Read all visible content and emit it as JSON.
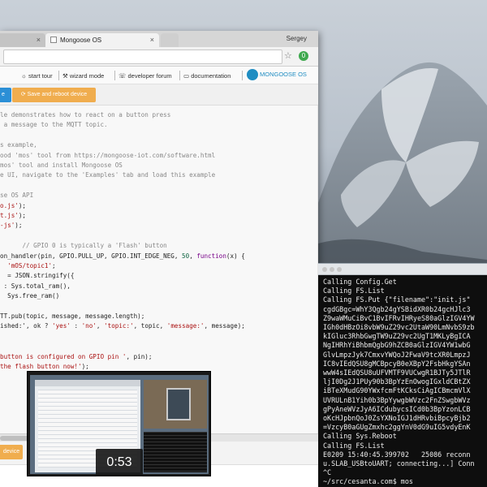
{
  "browser": {
    "tabs": [
      {
        "label": "",
        "active": false
      },
      {
        "label": "Mongoose OS",
        "active": true
      }
    ],
    "profile_name": "Sergey"
  },
  "nav": {
    "items": [
      {
        "icon": "lightbulb-icon",
        "glyph": "☼",
        "label": "start tour"
      },
      {
        "icon": "wand-icon",
        "glyph": "⚒",
        "label": "wizard mode"
      },
      {
        "icon": "chat-icon",
        "glyph": "☏",
        "label": "developer forum"
      },
      {
        "icon": "book-icon",
        "glyph": "▭",
        "label": "documentation"
      }
    ],
    "brand": "MONGOOSE OS"
  },
  "toolbar": {
    "left_button": "e",
    "save_button": "⟳ Save and reboot device"
  },
  "editor": {
    "lines": [
      [
        {
          "t": "le demonstrates how to react on a button press",
          "c": "c-com"
        }
      ],
      [
        {
          "t": " a message to the MQTT topic.",
          "c": "c-com"
        }
      ],
      [
        {
          "t": "",
          "c": ""
        }
      ],
      [
        {
          "t": "s example,",
          "c": "c-com"
        }
      ],
      [
        {
          "t": "ood 'mos' tool from https://mongoose-iot.com/software.html",
          "c": "c-com"
        }
      ],
      [
        {
          "t": "mos' tool and install Mongoose OS",
          "c": "c-com"
        }
      ],
      [
        {
          "t": "e UI, navigate to the 'Examples' tab and load this example",
          "c": "c-com"
        }
      ],
      [
        {
          "t": "",
          "c": ""
        }
      ],
      [
        {
          "t": "se OS API",
          "c": "c-com"
        }
      ],
      [
        {
          "t": "o.js'",
          "c": "c-str"
        },
        {
          "t": ");",
          "c": ""
        }
      ],
      [
        {
          "t": "t.js'",
          "c": "c-str"
        },
        {
          "t": ");",
          "c": ""
        }
      ],
      [
        {
          "t": "-js'",
          "c": "c-str"
        },
        {
          "t": ");",
          "c": ""
        }
      ],
      [
        {
          "t": "",
          "c": ""
        }
      ],
      [
        {
          "t": "      ",
          "c": ""
        },
        {
          "t": "// GPIO 0 is typically a 'Flash' button",
          "c": "c-com"
        }
      ],
      [
        {
          "t": "on_handler(pin, GPIO.PULL_UP, GPIO.INT_EDGE_NEG, ",
          "c": ""
        },
        {
          "t": "50",
          "c": "c-num"
        },
        {
          "t": ", ",
          "c": ""
        },
        {
          "t": "function",
          "c": "c-kw"
        },
        {
          "t": "(x) {",
          "c": ""
        }
      ],
      [
        {
          "t": "  ",
          "c": ""
        },
        {
          "t": "'mOS/topic1'",
          "c": "c-str"
        },
        {
          "t": ";",
          "c": ""
        }
      ],
      [
        {
          "t": "  = JSON.stringify({",
          "c": ""
        }
      ],
      [
        {
          "t": " : Sys.total_ram(),",
          "c": ""
        }
      ],
      [
        {
          "t": "  Sys.free_ram()",
          "c": ""
        }
      ],
      [
        {
          "t": "",
          "c": ""
        }
      ],
      [
        {
          "t": "TT.pub(topic, message, message.length);",
          "c": ""
        }
      ],
      [
        {
          "t": "ished:', ok ? ",
          "c": ""
        },
        {
          "t": "'yes'",
          "c": "c-str"
        },
        {
          "t": " : ",
          "c": ""
        },
        {
          "t": "'no'",
          "c": "c-str"
        },
        {
          "t": ", ",
          "c": ""
        },
        {
          "t": "'topic:'",
          "c": "c-str"
        },
        {
          "t": ", topic, ",
          "c": ""
        },
        {
          "t": "'message:'",
          "c": "c-str"
        },
        {
          "t": ", message);",
          "c": ""
        }
      ],
      [
        {
          "t": "",
          "c": ""
        }
      ],
      [
        {
          "t": "",
          "c": ""
        }
      ],
      [
        {
          "t": "button is configured on GPIO pin '",
          "c": "c-str"
        },
        {
          "t": ", pin);",
          "c": ""
        }
      ],
      [
        {
          "t": "the flash button now!'",
          "c": "c-str"
        },
        {
          "t": ");",
          "c": ""
        }
      ]
    ]
  },
  "lower": {
    "device_button": "device"
  },
  "terminal": {
    "lines": [
      "Calling Config.Get",
      "Calling FS.List",
      "Calling FS.Put {\"filename\":\"init.js\"",
      "cgdGBgc=WhY3Qgb24gYSBidXR0b24gcHJlc3",
      "Z9waWMuCiBvC1BvIFRvIHRyeS80aGlzIGV4YW",
      "IGh0dHBzOi8vbW9uZ29vc2UtaW90LmNvbS9zb",
      "kIGluc3RhbGwgTW9uZ29vc2UgT1MKLyBgICA",
      "NgIHRhYiBhbmQgbG9hZCB0aGlzIGV4YW1wbG",
      "GlvLmpzJyk7CmxvYWQoJ2FwaV9tcXR0LmpzJ",
      "IC8vIEdQSU8gMCBpcyB0eXBpY2FsbHkgYSAn",
      "wwW4sIEdQSU8uUFVMTF9VUCwgR1BJTy5JTlR",
      "ljI0Dg2J1PUy90b3BpYzEnOwogIGxldCBtZX",
      "iBTeXMudG90YWxfcmFtKCksCiAgICBmcmVlX",
      "UVRULnB1Yih0b3BpYywgbWVzc2FnZSwgbWVz",
      "gPyAneWVzJyA6ICdubycsICd0b3BpYzonLCB",
      "oKcHJpbnQoJ0ZsYXNoIGJ1dHRvbiBpcyBjb2",
      "=VzcyB0aGUgZmxhc2ggYnV0dG9uIG5vdyEnK",
      "Calling Sys.Reboot",
      "Calling FS.List",
      "E0209 15:40:45.399702   25086 reconn",
      "u.SLAB_USBtoUART; connecting...] Conn",
      "^C",
      "~/src/cesanta.com$ mos"
    ]
  },
  "video": {
    "duration": "0:53"
  },
  "colors": {
    "accent_blue": "#2b8fd6",
    "accent_orange": "#f0ad4e",
    "brand_blue": "#1f8dc2"
  }
}
